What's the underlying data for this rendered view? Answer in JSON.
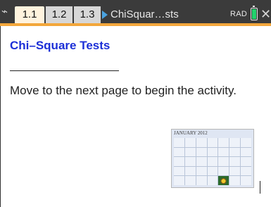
{
  "toolbar": {
    "tabs": [
      {
        "label": "1.1",
        "active": true
      },
      {
        "label": "1.2",
        "active": false
      },
      {
        "label": "1.3",
        "active": false
      }
    ],
    "document_name": "ChiSquar…sts",
    "angle_mode": "RAD",
    "battery_color": "#22d26c",
    "accent_color": "#f3a73b"
  },
  "page": {
    "title": "Chi–Square Tests",
    "instruction": "Move to the next page to begin the activity."
  },
  "image": {
    "caption": "JANUARY 2012"
  }
}
